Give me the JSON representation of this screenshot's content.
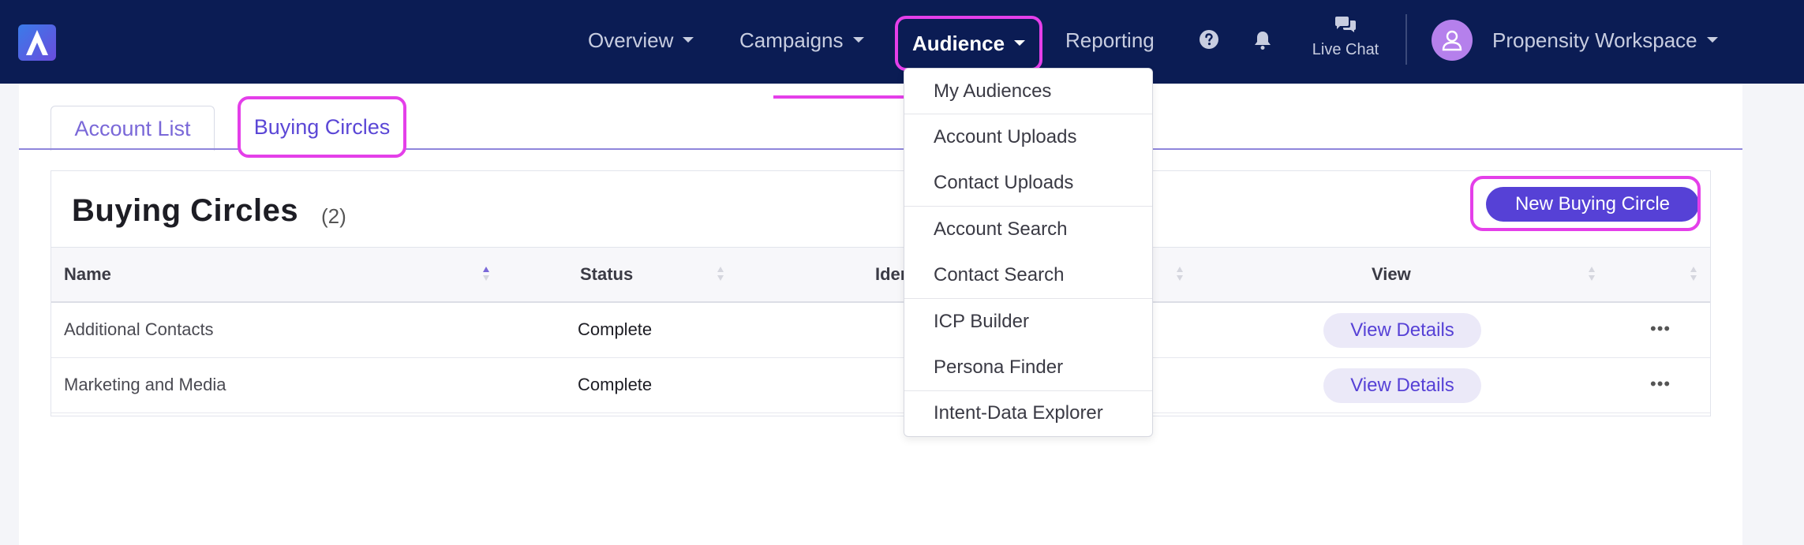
{
  "nav": {
    "items": [
      {
        "label": "Overview"
      },
      {
        "label": "Campaigns"
      },
      {
        "label": "Audience"
      },
      {
        "label": "Reporting"
      }
    ],
    "live_chat": "Live Chat",
    "workspace": "Propensity Workspace"
  },
  "audience_menu": {
    "items": [
      "My Audiences",
      "Account Uploads",
      "Contact Uploads",
      "Account Search",
      "Contact Search",
      "ICP Builder",
      "Persona Finder",
      "Intent-Data Explorer"
    ]
  },
  "tabs": [
    {
      "label": "Account List"
    },
    {
      "label": "Buying Circles"
    }
  ],
  "card": {
    "title": "Buying Circles",
    "count": "(2)",
    "new_button": "New Buying Circle"
  },
  "table": {
    "columns": [
      "Name",
      "Status",
      "Iden",
      "View"
    ],
    "rows": [
      {
        "name": "Additional Contacts",
        "status": "Complete",
        "view": "View Details"
      },
      {
        "name": "Marketing and Media",
        "status": "Complete",
        "view": "View Details"
      }
    ]
  },
  "colors": {
    "nav_bg": "#0b1c54",
    "highlight": "#e43fe9",
    "accent": "#5641d6"
  },
  "icons": [
    "app-logo-icon",
    "help-icon",
    "bell-icon",
    "chat-icon",
    "user-icon",
    "caret-down-icon",
    "sort-icon",
    "more-icon",
    "arrow-icon"
  ]
}
